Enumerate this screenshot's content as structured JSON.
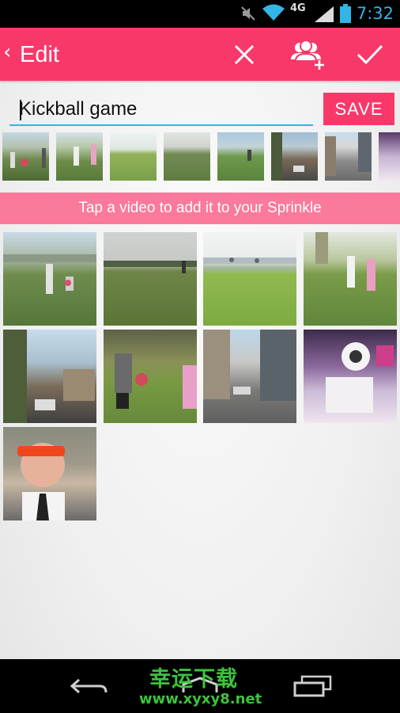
{
  "status_bar": {
    "time": "7:32",
    "network": "4G",
    "icons": [
      "mute-icon",
      "wifi-icon",
      "signal-icon",
      "battery-icon"
    ],
    "accent": "#33b5e5"
  },
  "action_bar": {
    "title": "Edit",
    "back_glyph": "‹",
    "buttons": [
      "close-icon",
      "add-people-icon",
      "checkmark-icon"
    ],
    "color": "#f9386a"
  },
  "editor": {
    "title_value": "Kickball game",
    "save_label": "SAVE"
  },
  "selected_strip": {
    "items": [
      "video-1",
      "video-2",
      "video-3",
      "video-4",
      "video-5",
      "video-6",
      "video-7",
      "video-8"
    ]
  },
  "banner": {
    "text": "Tap a video to add it to your Sprinkle",
    "color": "#f97a9a"
  },
  "library": {
    "items": [
      "video-1",
      "video-2",
      "video-3",
      "video-4",
      "video-5",
      "video-6",
      "video-7",
      "video-8",
      "video-9"
    ]
  },
  "watermark": {
    "chinese": "幸运下载",
    "url": "www.xyxy8.net",
    "color": "#3cc43c"
  },
  "nav_bar": {
    "buttons": [
      "back-icon",
      "home-icon",
      "recents-icon"
    ]
  }
}
